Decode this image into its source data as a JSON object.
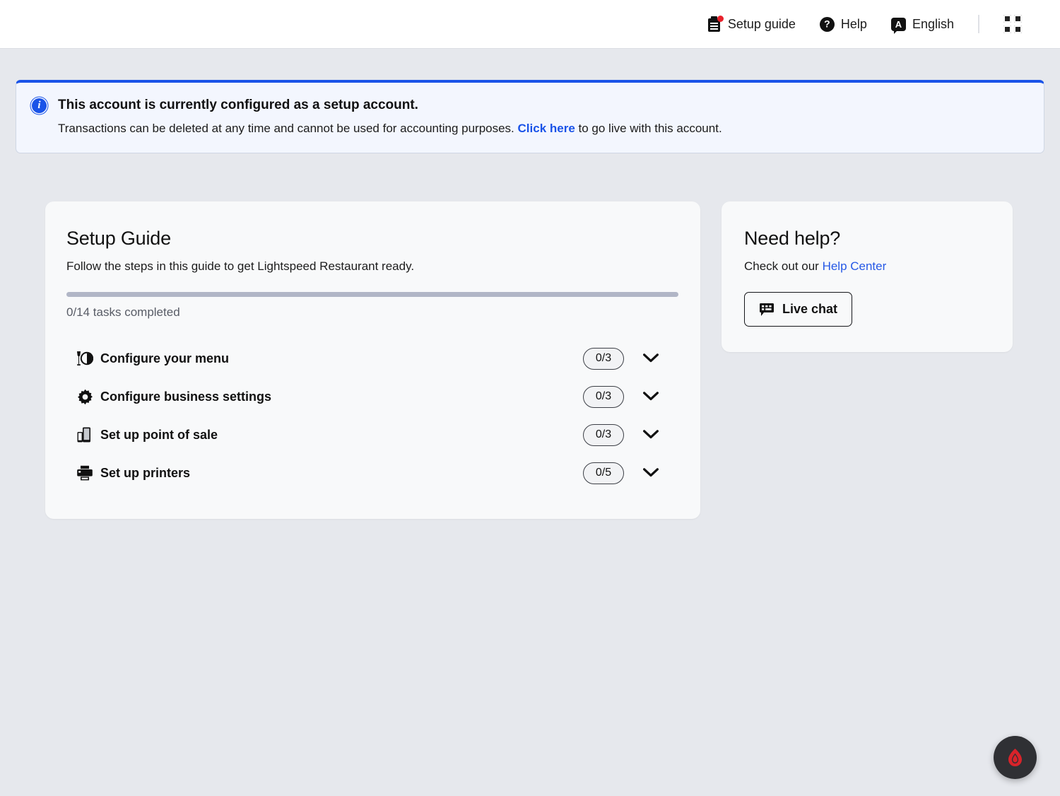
{
  "topbar": {
    "items": [
      {
        "label": "Setup guide",
        "icon": "clipboard-icon",
        "badge": true
      },
      {
        "label": "Help",
        "icon": "question-circle-icon",
        "glyph": "?"
      },
      {
        "label": "English",
        "icon": "language-icon",
        "glyph": "A"
      }
    ],
    "apps_icon": "grid-apps-icon"
  },
  "banner": {
    "icon": "info-icon",
    "icon_glyph": "i",
    "title": "This account is currently configured as a setup account.",
    "text_before_link": "Transactions can be deleted at any time and cannot be used for accounting purposes. ",
    "link_label": "Click here",
    "text_after_link": " to go live with this account.",
    "accent_color": "#1a53e8",
    "background_color": "#f3f6fe"
  },
  "setup_guide": {
    "title": "Setup Guide",
    "subtitle": "Follow the steps in this guide to get Lightspeed Restaurant ready.",
    "progress_percent": 0,
    "progress_caption": "0/14 tasks completed",
    "tasks": [
      {
        "label": "Configure your menu",
        "badge": "0/3",
        "icon": "menu-dining-icon",
        "chevron": "chevron-down-icon"
      },
      {
        "label": "Configure business settings",
        "badge": "0/3",
        "icon": "gear-icon",
        "chevron": "chevron-down-icon"
      },
      {
        "label": "Set up point of sale",
        "badge": "0/3",
        "icon": "devices-icon",
        "chevron": "chevron-down-icon"
      },
      {
        "label": "Set up printers",
        "badge": "0/5",
        "icon": "printer-icon",
        "chevron": "chevron-down-icon"
      }
    ]
  },
  "need_help": {
    "title": "Need help?",
    "text_before_link": "Check out our ",
    "link_label": "Help Center",
    "live_chat_label": "Live chat",
    "live_chat_icon": "chat-bubble-icon"
  },
  "fab": {
    "icon": "lightspeed-flame-icon",
    "color": "#d8232a",
    "background": "#2f3034"
  }
}
